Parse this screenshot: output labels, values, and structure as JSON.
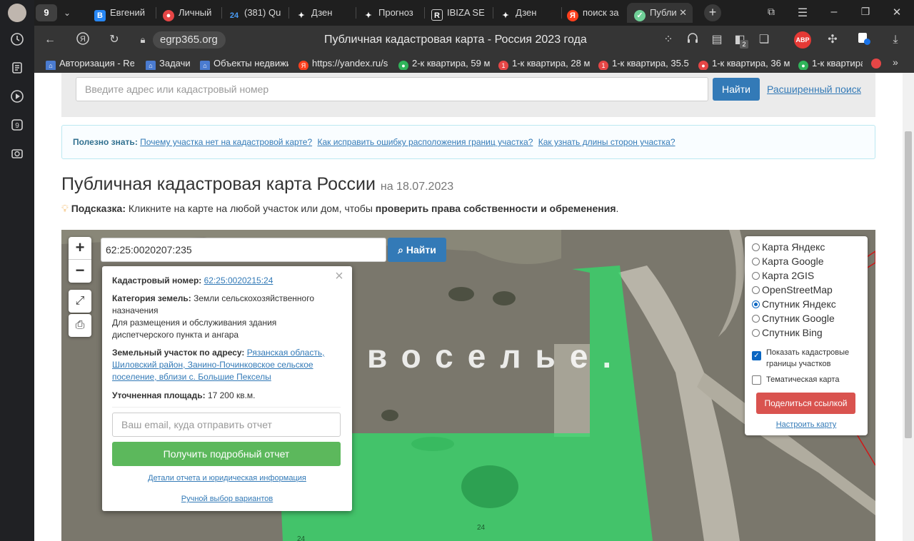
{
  "tabs": {
    "count": "9",
    "items": [
      {
        "label": "Евгений",
        "icon": "vk-icon",
        "color": "#2787f5"
      },
      {
        "label": "Личный",
        "icon": "record-icon",
        "color": "#e64646"
      },
      {
        "label": "(381) Qu",
        "icon": "24-icon",
        "color": "#1a73e8"
      },
      {
        "label": "Дзен",
        "icon": "dzen-icon",
        "color": "#000000"
      },
      {
        "label": "Прогноз",
        "icon": "dzen-icon",
        "color": "#000000"
      },
      {
        "label": "IBIZA SE",
        "icon": "r-icon",
        "color": "#3a3a6a"
      },
      {
        "label": "Дзен",
        "icon": "dzen-icon",
        "color": "#000000"
      },
      {
        "label": "поиск за",
        "icon": "yandex-icon",
        "color": "#fc3f1d"
      },
      {
        "label": "Публи",
        "icon": "check-circle-icon",
        "color": "#6fcf97"
      }
    ]
  },
  "toolbar": {
    "url": "egrp365.org",
    "page_title": "Публичная кадастровая карта - Россия 2023 года",
    "abp_label": "ABP",
    "extensions_badge": "2"
  },
  "bookmarks": [
    {
      "label": "Авторизация - Re",
      "color": "#4a7bd0"
    },
    {
      "label": "Задачи",
      "color": "#4a7bd0"
    },
    {
      "label": "Объекты недвижи",
      "color": "#4a7bd0"
    },
    {
      "label": "https://yandex.ru/s",
      "color": "#fc3f1d"
    },
    {
      "label": "2-к квартира, 59 м",
      "color": "#2fb45a"
    },
    {
      "label": "1-к квартира, 28 м",
      "color": "#e64646"
    },
    {
      "label": "1-к квартира, 35.5",
      "color": "#e64646"
    },
    {
      "label": "1-к квартира, 36 м",
      "color": "#e64646"
    },
    {
      "label": "1-к квартира",
      "color": "#2fb45a"
    }
  ],
  "search": {
    "placeholder": "Введите адрес или кадастровый номер",
    "button": "Найти",
    "advanced_link": "Расширенный поиск"
  },
  "info": {
    "prefix": "Полезно знать:",
    "links": [
      "Почему участка нет на кадастровой карте?",
      "Как исправить ошибку расположения границ участка?",
      "Как узнать длины сторон участка?"
    ]
  },
  "heading": {
    "title": "Публичная кадастровая карта России",
    "date": "на 18.07.2023"
  },
  "hint": {
    "label": "Подсказка:",
    "text": "Кликните на карте на любой участок или дом, чтобы",
    "bold": "проверить права собственности и обременения",
    "end": "."
  },
  "map": {
    "cad_input": "62:25:0020207:235",
    "find_button": "Найти",
    "overlay_text": "восельe.",
    "parcel_numbers": [
      "24",
      "24"
    ]
  },
  "popup": {
    "cad_label": "Кадастровый номер:",
    "cad_value": "62:25:0020215:24",
    "cat_label": "Категория земель:",
    "cat_value": "Земли сельскохозяйственного назначения",
    "usage": "Для размещения и обслуживания здания диспетчерского пункта и ангара",
    "addr_label": "Земельный участок по адресу:",
    "addr_value": "Рязанская область, Шиловский район, Занино-Починковское сельское поселение, вблизи с. Большие Пекселы",
    "area_label": "Уточненная площадь:",
    "area_value": "17 200 кв.м.",
    "email_placeholder": "Ваш email, куда отправить отчет",
    "report_button": "Получить подробный отчет",
    "details_link": "Детали отчета и юридическая информация",
    "manual_link": "Ручной выбор вариантов"
  },
  "layers": {
    "options": [
      {
        "label": "Карта Яндекс",
        "selected": false
      },
      {
        "label": "Карта Google",
        "selected": false
      },
      {
        "label": "Карта 2GIS",
        "selected": false
      },
      {
        "label": "OpenStreetMap",
        "selected": false
      },
      {
        "label": "Спутник Яндекс",
        "selected": true
      },
      {
        "label": "Спутник Google",
        "selected": false
      },
      {
        "label": "Спутник Bing",
        "selected": false
      }
    ],
    "show_borders": "Показать кадастровые границы участков",
    "thematic": "Тематическая карта",
    "share_button": "Поделиться ссылкой",
    "settings_link": "Настроить карту"
  }
}
